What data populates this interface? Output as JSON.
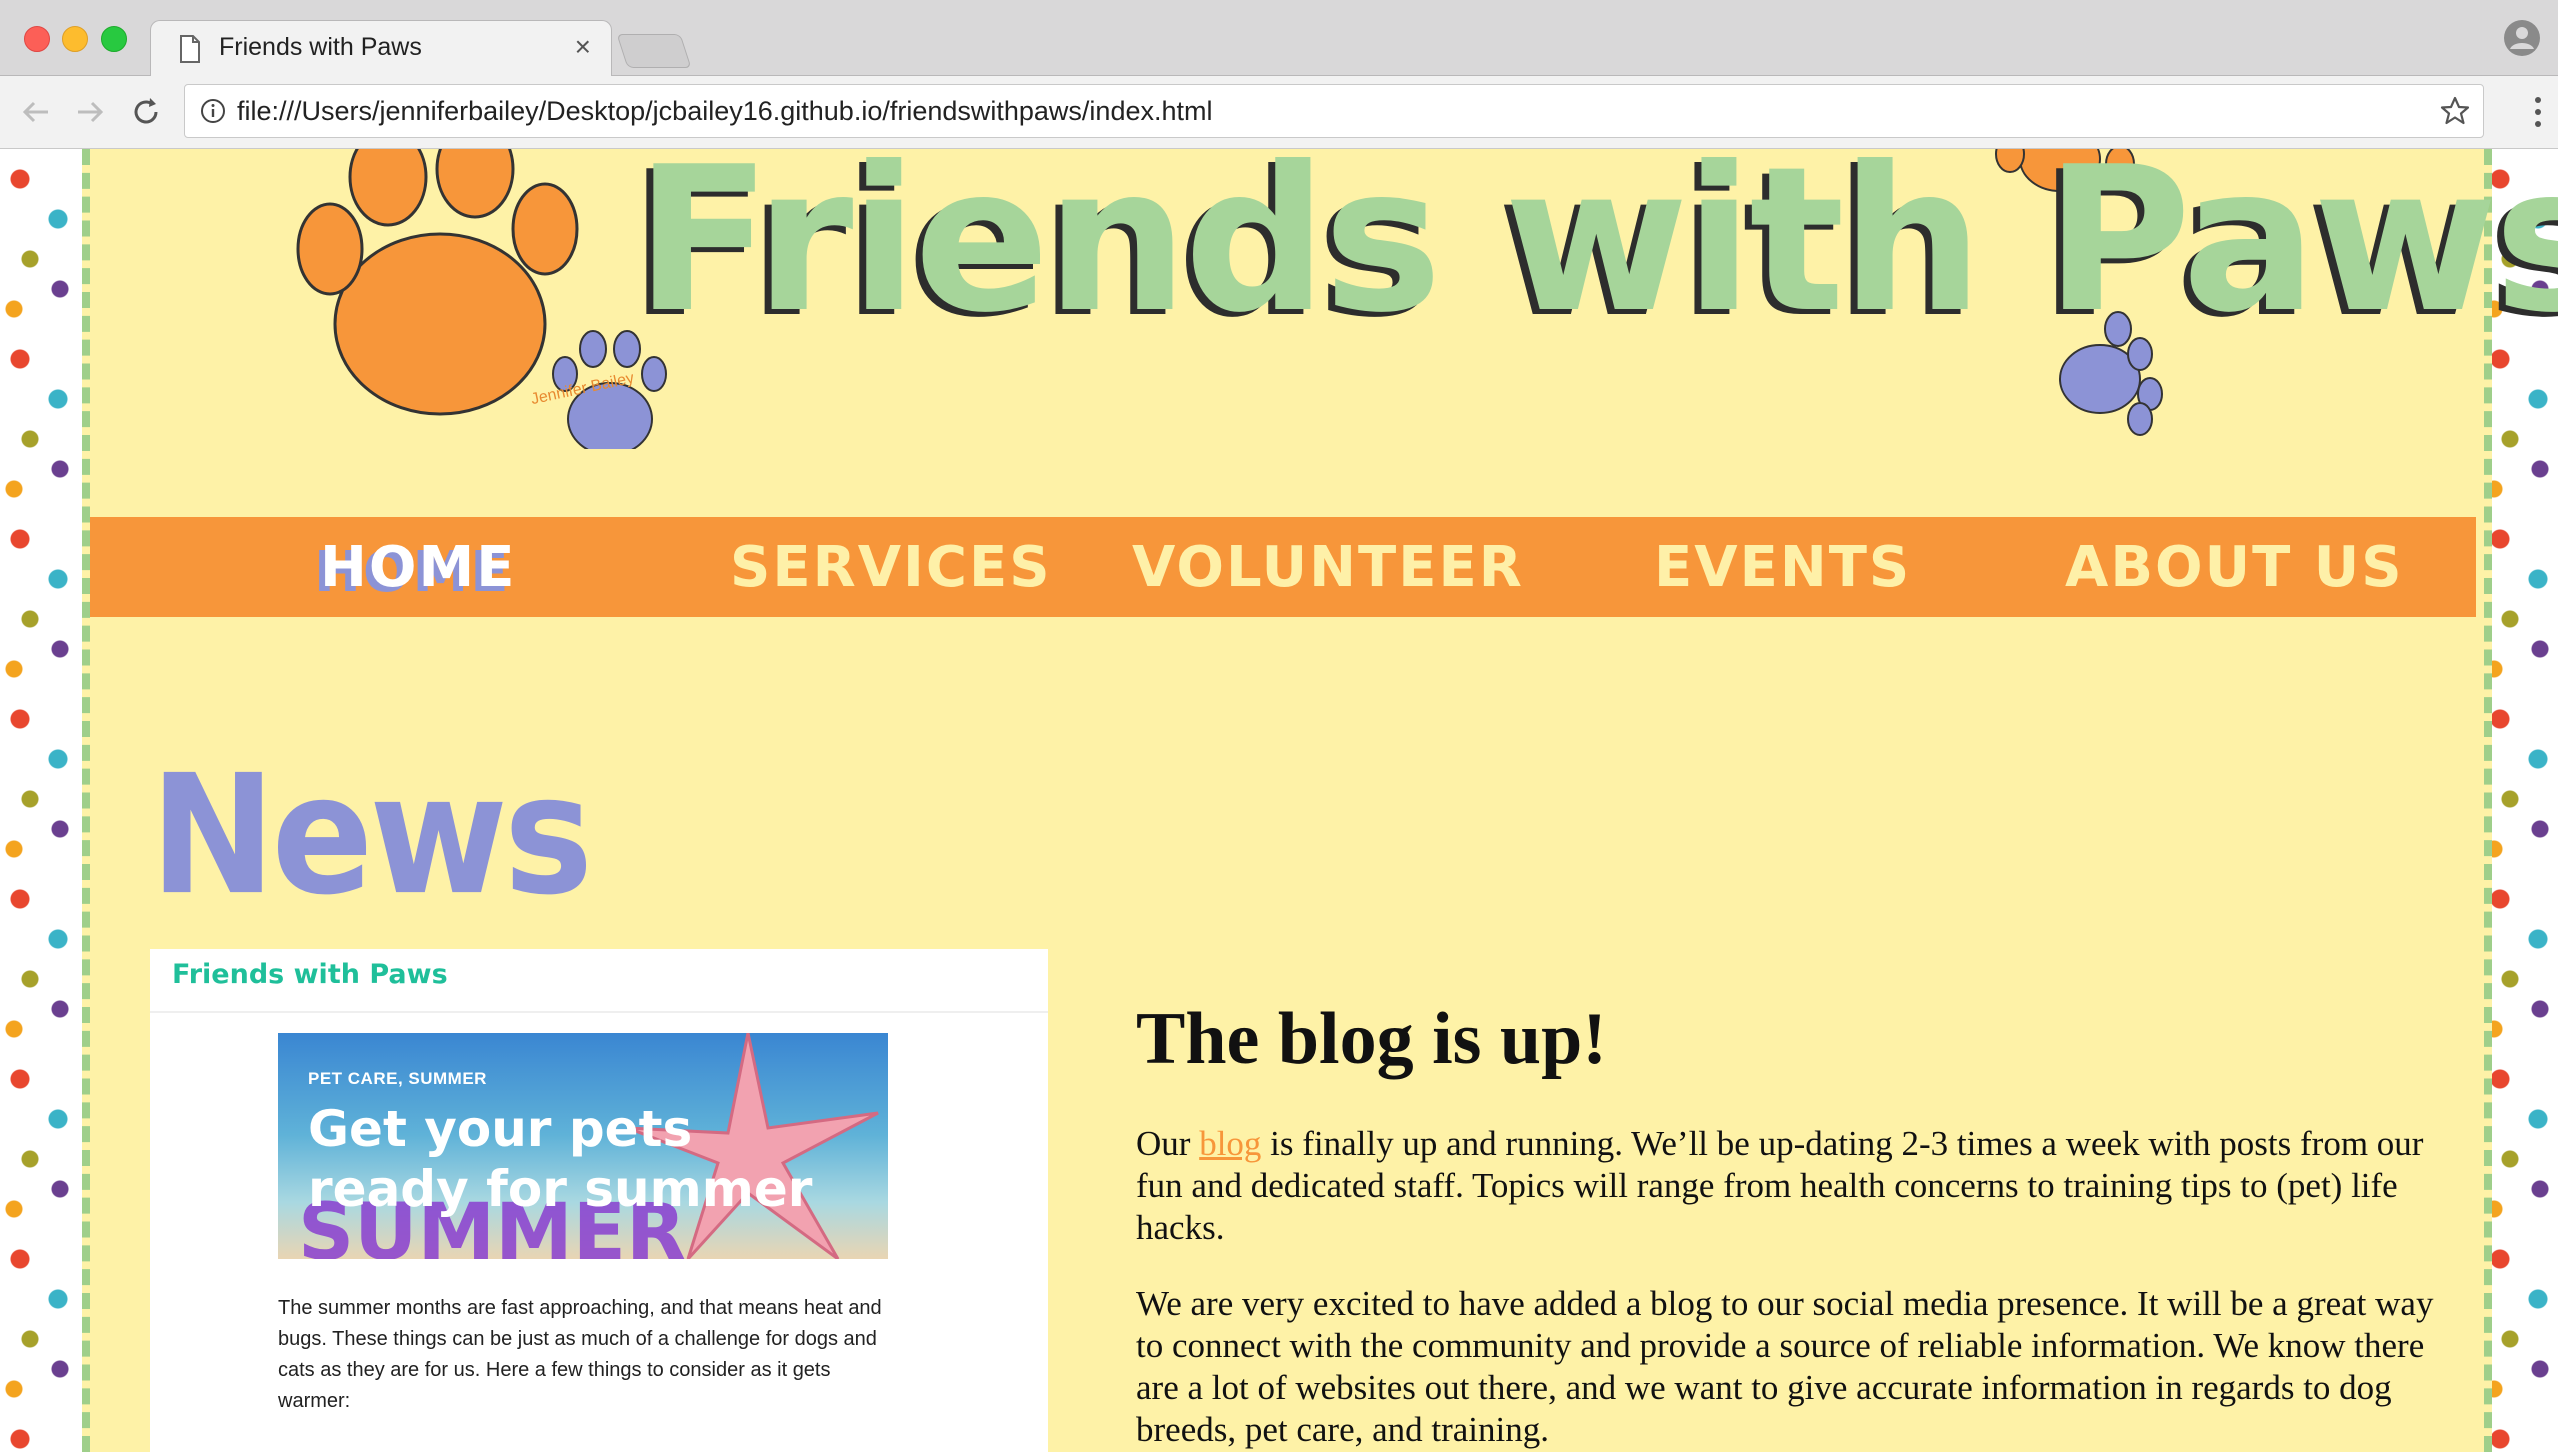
{
  "browser": {
    "tab_title": "Friends with Paws",
    "tab_close": "×",
    "url": "file:///Users/jenniferbailey/Desktop/jcbailey16.github.io/friendswithpaws/index.html"
  },
  "header": {
    "site_title": "Friends with Paws",
    "signature": "Jennifer Bailey"
  },
  "nav": {
    "items": [
      {
        "label": "HOME",
        "active": true
      },
      {
        "label": "SERVICES",
        "active": false
      },
      {
        "label": "VOLUNTEER",
        "active": false
      },
      {
        "label": "EVENTS",
        "active": false
      },
      {
        "label": "ABOUT US",
        "active": false
      }
    ]
  },
  "news": {
    "heading": "News",
    "card": {
      "brand": "Friends with Paws",
      "category": "PET CARE, SUMMER",
      "post_title": "Get your pets ready for summer",
      "image_word": "SUMMER",
      "excerpt": "The summer months are fast approaching, and that means heat and bugs. These things can be just as much of a challenge for dogs and cats as they are for us. Here a few things to consider as it gets warmer:"
    },
    "article": {
      "title": "The blog is up!",
      "p1_before": "Our ",
      "p1_link": "blog",
      "p1_after": " is finally up and running. We’ll be up-dating 2-3 times a week with posts from our fun and dedicated staff. Topics will range from health concerns to training tips to (pet) life hacks.",
      "p2": "We are very excited to have added a blog to our social media presence. It will be a great way to connect with the community and provide a source of reliable information. We know there are a lot of websites out there, and we want to give accurate information in regards to dog breeds, pet care, and training."
    }
  },
  "colors": {
    "page_bg": "#fef2a7",
    "nav_bg": "#f7963a",
    "title_green": "#a6d59a",
    "accent_purple": "#8c93d6",
    "brand_teal": "#1fbf9a"
  }
}
